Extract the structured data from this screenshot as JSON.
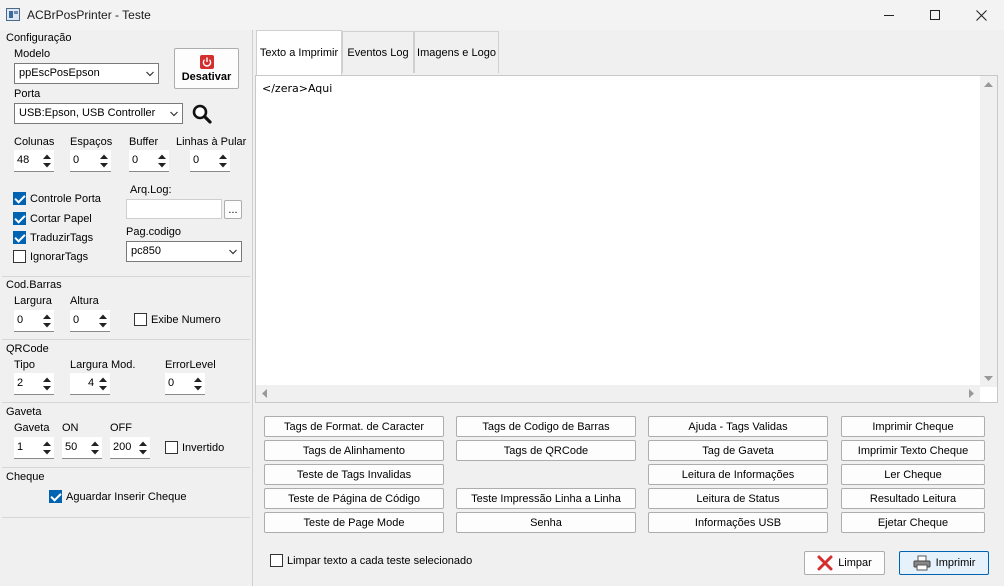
{
  "window": {
    "title": "ACBrPosPrinter - Teste"
  },
  "config": {
    "group_label": "Configuração",
    "modelo_label": "Modelo",
    "modelo_value": "ppEscPosEpson",
    "desativar_label": "Desativar",
    "porta_label": "Porta",
    "porta_value": "USB:Epson, USB Controller",
    "colunas_label": "Colunas",
    "colunas_value": "48",
    "espacos_label": "Espaços",
    "espacos_value": "0",
    "buffer_label": "Buffer",
    "buffer_value": "0",
    "linhas_label": "Linhas à Pular",
    "linhas_value": "0",
    "controle_porta": "Controle Porta",
    "cortar_papel": "Cortar Papel",
    "traduzir_tags": "TraduzirTags",
    "ignorar_tags": "IgnorarTags",
    "arqlog_label": "Arq.Log:",
    "arqlog_value": "",
    "browse_label": "...",
    "pagcodigo_label": "Pag.codigo",
    "pagcodigo_value": "pc850"
  },
  "barcode": {
    "group_label": "Cod.Barras",
    "largura_label": "Largura",
    "largura_value": "0",
    "altura_label": "Altura",
    "altura_value": "0",
    "exibe_numero": "Exibe Numero"
  },
  "qrcode": {
    "group_label": "QRCode",
    "tipo_label": "Tipo",
    "tipo_value": "2",
    "largura_mod_label": "Largura Mod.",
    "largura_mod_value": "4",
    "errorlevel_label": "ErrorLevel",
    "errorlevel_value": "0"
  },
  "gaveta": {
    "group_label": "Gaveta",
    "gaveta_label": "Gaveta",
    "gaveta_value": "1",
    "on_label": "ON",
    "on_value": "50",
    "off_label": "OFF",
    "off_value": "200",
    "invertido": "Invertido"
  },
  "cheque": {
    "group_label": "Cheque",
    "aguardar": "Aguardar Inserir Cheque"
  },
  "tabs": [
    "Texto a Imprimir",
    "Eventos Log",
    "Imagens e Logo"
  ],
  "editor": {
    "text": "</zera>Aqui"
  },
  "buttons": {
    "col1": [
      "Tags de Format. de Caracter",
      "Tags de Alinhamento",
      "Teste de Tags Invalidas",
      "Teste de Página de Código",
      "Teste de Page Mode"
    ],
    "col2": [
      "Tags de Codigo de Barras",
      "Tags de QRCode",
      "Teste Impressão Linha a Linha",
      "Senha"
    ],
    "col3": [
      "Ajuda - Tags Validas",
      "Tag de Gaveta",
      "Leitura de Informações",
      "Leitura de Status",
      "Informações USB"
    ],
    "col4": [
      "Imprimir Cheque",
      "Imprimir Texto Cheque",
      "Ler Cheque",
      "Resultado Leitura",
      "Ejetar Cheque"
    ]
  },
  "footer": {
    "limpar_texto": "Limpar texto a cada teste selecionado",
    "limpar_label": "Limpar",
    "imprimir_label": "Imprimir"
  },
  "checks": {
    "controle_porta": true,
    "cortar_papel": true,
    "traduzir_tags": true,
    "ignorar_tags": false,
    "exibe_numero": false,
    "invertido": false,
    "aguardar": true,
    "limpar_texto": false
  },
  "colors": {
    "accent": "#0063b1",
    "danger": "#d32f2f",
    "background": "#f0f0f0"
  }
}
